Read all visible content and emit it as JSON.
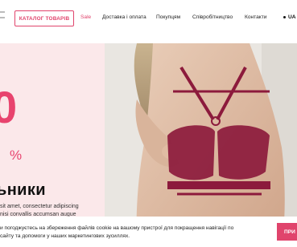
{
  "header": {
    "catalog_button": "КАТАЛОГ ТОВАРІВ",
    "nav": [
      "Sale",
      "Доставка і оплата",
      "Покупцям",
      "Співробітництво",
      "Контакти"
    ],
    "language": "UA"
  },
  "hero": {
    "promo_value": "0",
    "promo_unit": "%",
    "title": "ьники",
    "description_lines": [
      "sit amet, consectetur adipiscing",
      "nisi convallis accumsan augue"
    ]
  },
  "cookie": {
    "text_lines": [
      "и погоджуєтесь на збереження файлів cookie на вашому пристрої для покращення навігації по",
      "сайту та допомоги у наших маркетингових зусиллях."
    ],
    "accept_label": "ПРИ"
  },
  "colors": {
    "accent": "#e0446c",
    "hero_bg": "#fbe8ea",
    "lingerie": "#8c1a3c"
  }
}
